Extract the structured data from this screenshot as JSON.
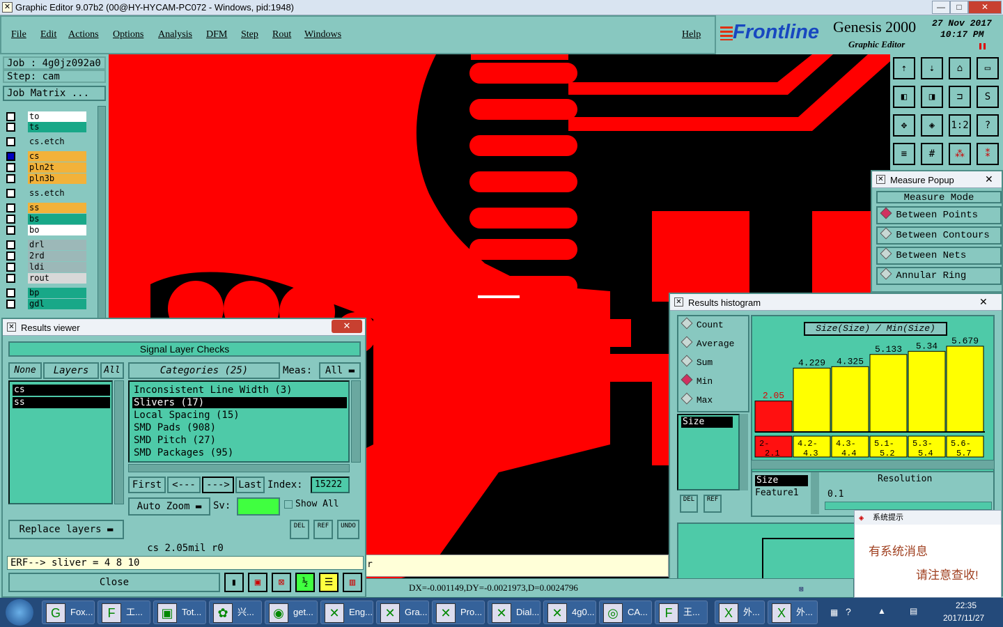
{
  "window": {
    "title": "Graphic Editor 9.07b2 (00@HY-HYCAM-PC072 - Windows, pid:1948)",
    "min": "—",
    "max": "□",
    "close": "✕"
  },
  "menu": {
    "items": [
      "File",
      "Edit",
      "Actions",
      "Options",
      "Analysis",
      "DFM",
      "Step",
      "Rout",
      "Windows"
    ],
    "help": "Help"
  },
  "brand": {
    "logo": "Frontline",
    "product": "Genesis 2000",
    "subtitle": "Graphic Editor",
    "date": "27 Nov 2017",
    "time": "10:17 PM"
  },
  "job": {
    "job": "Job : 4g0jz092a0",
    "step": "Step: cam",
    "matrix": "Job Matrix ..."
  },
  "layers": [
    {
      "name": "to",
      "color": "#ffffff",
      "on": false
    },
    {
      "name": "ts",
      "color": "#18a888",
      "on": false
    },
    {
      "name": "cs.etch",
      "color": "#88c8c0",
      "on": false
    },
    {
      "name": "cs",
      "color": "#f2b23a",
      "on": true
    },
    {
      "name": "pln2t",
      "color": "#f2b23a",
      "on": false
    },
    {
      "name": "pln3b",
      "color": "#f2b23a",
      "on": false
    },
    {
      "name": "ss.etch",
      "color": "#88c8c0",
      "on": false
    },
    {
      "name": "ss",
      "color": "#f2b23a",
      "on": false
    },
    {
      "name": "bs",
      "color": "#18a888",
      "on": false
    },
    {
      "name": "bo",
      "color": "#ffffff",
      "on": false
    },
    {
      "name": "drl",
      "color": "#9cb8b8",
      "on": false
    },
    {
      "name": "2rd",
      "color": "#9cb8b8",
      "on": false
    },
    {
      "name": "ldi",
      "color": "#9cb8b8",
      "on": false
    },
    {
      "name": "rout",
      "color": "#d8d8d8",
      "on": false
    },
    {
      "name": "bp",
      "color": "#18a888",
      "on": false
    },
    {
      "name": "gdl",
      "color": "#18a888",
      "on": false
    }
  ],
  "results_viewer": {
    "title": "Results viewer",
    "header": "Signal Layer Checks",
    "none": "None",
    "layers": "Layers",
    "all": "All",
    "selected_layers": [
      "cs",
      "ss"
    ],
    "categories_label": "Categories (25)",
    "meas_label": "Meas:",
    "meas_value": "All",
    "categories": [
      "Inconsistent Line Width (3)",
      "Slivers (17)",
      "Local Spacing (15)",
      "SMD Pads (908)",
      "SMD Pitch (27)",
      "SMD Packages (95)"
    ],
    "selected_category": 1,
    "nav": {
      "first": "First",
      "prev": "<---",
      "next": "--->",
      "last": "Last",
      "index_label": "Index:",
      "index_value": "15222"
    },
    "auto_zoom": "Auto Zoom",
    "sv": "Sv:",
    "show_all": "Show All",
    "replace_layers": "Replace layers",
    "del": "DEL",
    "ref": "REF",
    "undo": "UNDO",
    "status": "cs  2.05mil  r0",
    "erf": "ERF--> sliver = 4 8 10",
    "close": "Close"
  },
  "measure_popup": {
    "title": "Measure Popup",
    "mode": "Measure Mode",
    "options": [
      "Between Points",
      "Between Contours",
      "Between Nets",
      "Annular Ring"
    ],
    "selected": 0
  },
  "histogram": {
    "title": "Results histogram",
    "stats": [
      "Count",
      "Average",
      "Sum",
      "Min",
      "Max"
    ],
    "stat_selected": 3,
    "field": "Size",
    "formula": "Size(Size) / Min(Size)",
    "res_fields": [
      "Size",
      "Feature1"
    ],
    "resolution_label": "Resolution",
    "resolution_value": "0.1",
    "del": "DEL",
    "ref": "REF"
  },
  "chart_data": {
    "type": "bar",
    "categories": [
      "2-2.1",
      "4.2-4.3",
      "4.3-4.4",
      "5.1-5.2",
      "5.3-5.4",
      "5.6-5.7"
    ],
    "values": [
      2.05,
      4.229,
      4.325,
      5.133,
      5.34,
      5.679
    ],
    "labels": [
      "2.05",
      "4.229",
      "4.325",
      "5.133",
      "5.34",
      "5.679"
    ],
    "cat_top": [
      "2-",
      "4.2-",
      "4.3-",
      "5.1-",
      "5.3-",
      "5.6-"
    ],
    "cat_bot": [
      "2.1",
      "4.3",
      "4.4",
      "5.2",
      "5.4",
      "5.7"
    ],
    "colors": [
      "#ff1010",
      "#ffff00",
      "#ffff00",
      "#ffff00",
      "#ffff00",
      "#ffff00"
    ],
    "ylim": [
      0,
      6
    ]
  },
  "status_bar": {
    "coords": "DX=-0.001149,DY=-0.0021973,D=0.0024796",
    "r": "r"
  },
  "notify": {
    "title": "系统提示",
    "line1": "有系统消息",
    "line2": "请注意查收!"
  },
  "taskbar": {
    "items": [
      {
        "label": "Fox...",
        "icon": "G"
      },
      {
        "label": "工...",
        "icon": "F"
      },
      {
        "label": "Tot...",
        "icon": "▣"
      },
      {
        "label": "兴...",
        "icon": "✿"
      },
      {
        "label": "get...",
        "icon": "◉"
      },
      {
        "label": "Eng...",
        "icon": "✕"
      },
      {
        "label": "Gra...",
        "icon": "✕"
      },
      {
        "label": "Pro...",
        "icon": "✕"
      },
      {
        "label": "Dial...",
        "icon": "✕"
      },
      {
        "label": "4g0...",
        "icon": "✕"
      },
      {
        "label": "CA...",
        "icon": "◎"
      },
      {
        "label": "王...",
        "icon": "F"
      },
      {
        "label": "外...",
        "icon": "X"
      },
      {
        "label": "外...",
        "icon": "X"
      }
    ],
    "clock_time": "22:35",
    "clock_date": "2017/11/27"
  }
}
